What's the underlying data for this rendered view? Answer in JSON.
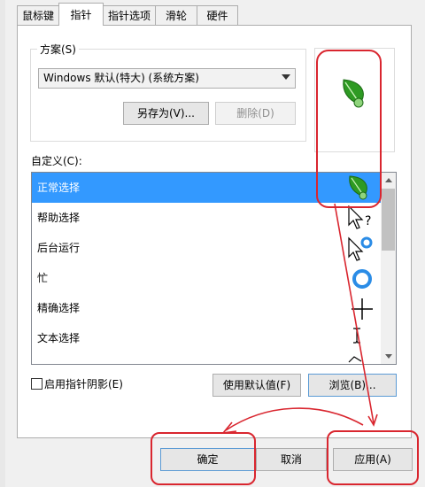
{
  "tabs": [
    "鼠标键",
    "指针",
    "指针选项",
    "滑轮",
    "硬件"
  ],
  "active_tab_index": 1,
  "scheme": {
    "group_label": "方案(S)",
    "selected": "Windows 默认(特大) (系统方案)",
    "save_as": "另存为(V)...",
    "delete": "删除(D)"
  },
  "customize_label": "自定义(C):",
  "cursor_list": [
    {
      "name": "正常选择",
      "icon": "green-leaf-cursor-icon",
      "selected": true
    },
    {
      "name": "帮助选择",
      "icon": "help-select-cursor-icon",
      "selected": false
    },
    {
      "name": "后台运行",
      "icon": "working-in-background-cursor-icon",
      "selected": false
    },
    {
      "name": "忙",
      "icon": "busy-ring-cursor-icon",
      "selected": false
    },
    {
      "name": "精确选择",
      "icon": "precision-crosshair-cursor-icon",
      "selected": false
    },
    {
      "name": "文本选择",
      "icon": "text-ibeam-cursor-icon",
      "selected": false
    }
  ],
  "shadow_checkbox": {
    "label": "启用指针阴影(E)",
    "checked": false
  },
  "use_default": "使用默认值(F)",
  "browse": "浏览(B)...",
  "ok": "确定",
  "cancel": "取消",
  "apply": "应用(A)",
  "colors": {
    "selection": "#3399ff",
    "annotation": "#d9262f",
    "leaf": "#2e9a23"
  }
}
